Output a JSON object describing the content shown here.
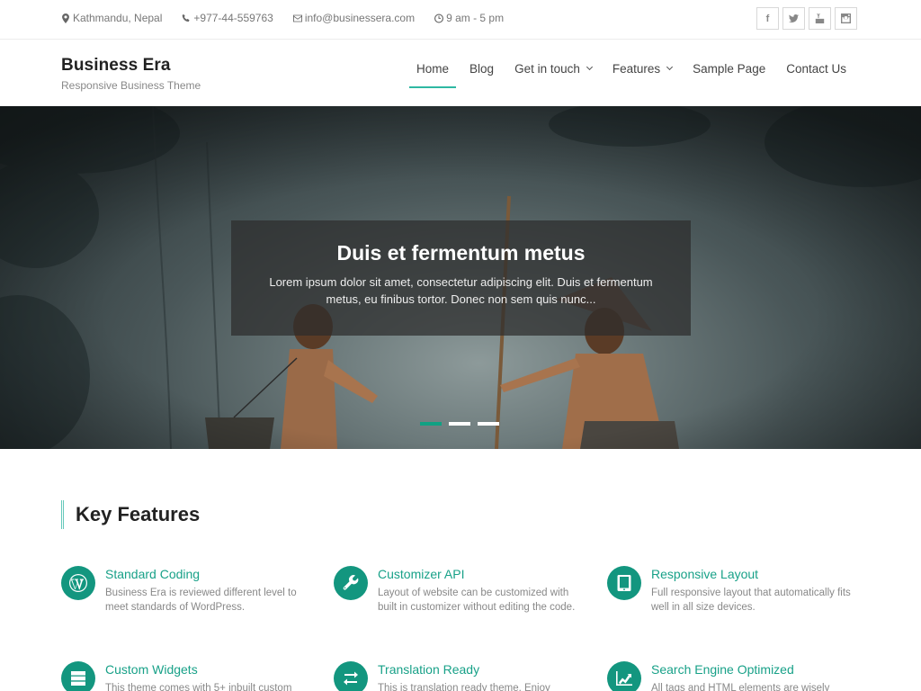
{
  "topbar": {
    "contacts": [
      {
        "icon": "map-marker-icon",
        "text": "Kathmandu, Nepal"
      },
      {
        "icon": "phone-icon",
        "text": "+977-44-559763"
      },
      {
        "icon": "envelope-icon",
        "text": "info@businessera.com"
      },
      {
        "icon": "clock-icon",
        "text": "9 am - 5 pm"
      }
    ],
    "social": [
      {
        "icon": "facebook-icon",
        "glyph": "f"
      },
      {
        "icon": "twitter-icon",
        "glyph": ""
      },
      {
        "icon": "youtube-icon",
        "glyph": ""
      },
      {
        "icon": "instagram-icon",
        "glyph": ""
      }
    ]
  },
  "header": {
    "site_title": "Business Era",
    "tagline": "Responsive Business Theme",
    "nav": [
      {
        "label": "Home",
        "active": true,
        "dropdown": false
      },
      {
        "label": "Blog",
        "active": false,
        "dropdown": false
      },
      {
        "label": "Get in touch",
        "active": false,
        "dropdown": true
      },
      {
        "label": "Features",
        "active": false,
        "dropdown": true
      },
      {
        "label": "Sample Page",
        "active": false,
        "dropdown": false
      },
      {
        "label": "Contact Us",
        "active": false,
        "dropdown": false
      }
    ]
  },
  "hero": {
    "title": "Duis et fermentum metus",
    "description": "Lorem ipsum dolor sit amet, consectetur adipiscing elit. Duis et fermentum metus, eu finibus tortor. Donec non sem quis nunc...",
    "slides_total": 3,
    "active_slide": 1
  },
  "features": {
    "title": "Key Features",
    "items": [
      {
        "icon": "wordpress-icon",
        "title": "Standard Coding",
        "desc": "Business Era is reviewed different level to meet standards of WordPress."
      },
      {
        "icon": "wrench-icon",
        "title": "Customizer API",
        "desc": "Layout of website can be customized with built in customizer without editing the code."
      },
      {
        "icon": "tablet-icon",
        "title": "Responsive Layout",
        "desc": "Full responsive layout that automatically fits well in all size devices."
      },
      {
        "icon": "server-icon",
        "title": "Custom Widgets",
        "desc": "This theme comes with 5+ inbuilt custom"
      },
      {
        "icon": "exchange-icon",
        "title": "Translation Ready",
        "desc": "This is translation ready theme. Enjoy"
      },
      {
        "icon": "area-chart-icon",
        "title": "Search Engine Optimized",
        "desc": "All tags and HTML elements are wisely"
      }
    ]
  },
  "colors": {
    "accent": "#13967f",
    "accent_text": "#18a188",
    "nav_underline": "#2fb8a2",
    "slider_dot_active": "#10a183"
  }
}
